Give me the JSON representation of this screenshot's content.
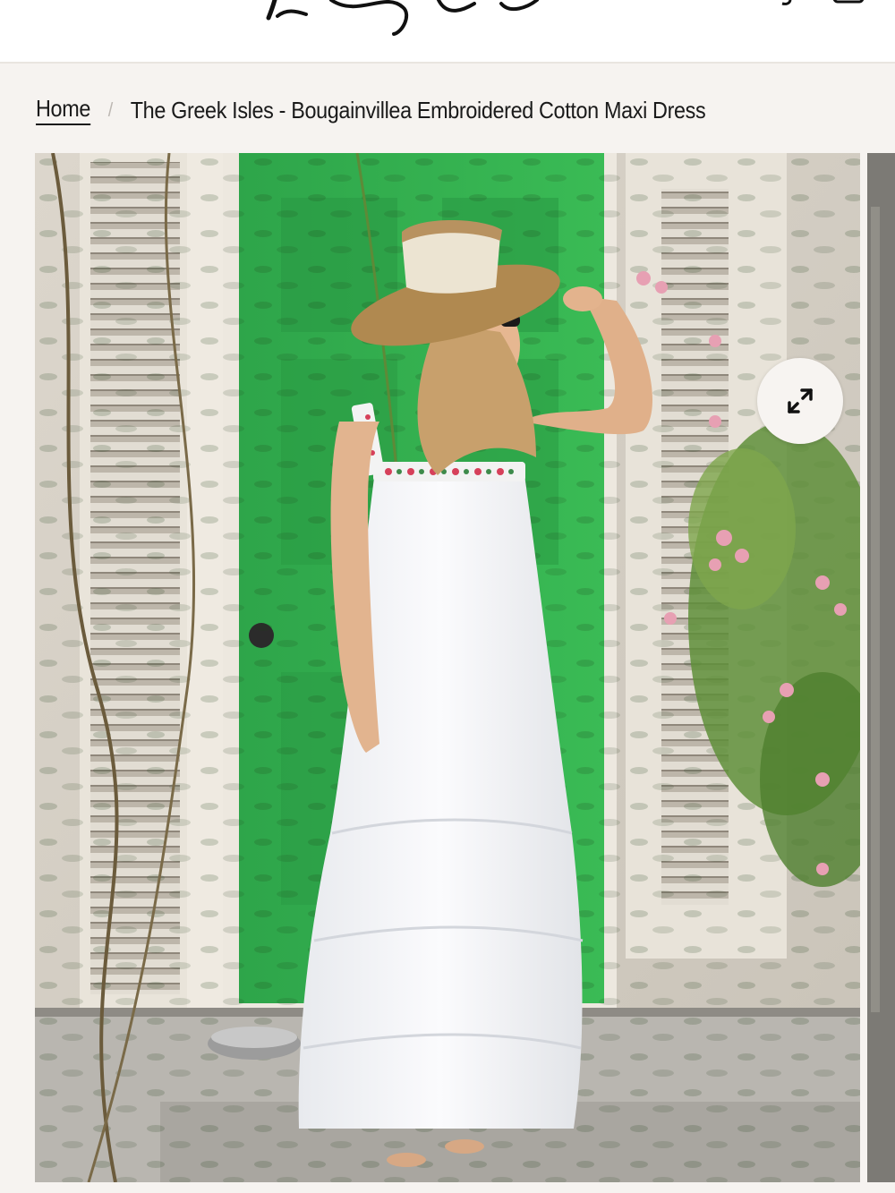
{
  "header": {
    "logo_alt": "store logo (script wordmark)",
    "icons": [
      "search-icon",
      "cart-icon"
    ]
  },
  "breadcrumb": {
    "home_label": "Home",
    "separator": "/",
    "current": "The Greek Isles - Bougainvillea Embroidered Cotton Maxi Dress"
  },
  "gallery": {
    "main_image_alt": "Woman in white embroidered cotton maxi dress and straw hat standing in front of a green door",
    "zoom_icon": "expand-icon"
  },
  "colors": {
    "page_bg": "#f6f3f0",
    "door_green": "#2fa84a",
    "text": "#1a1a1a"
  }
}
